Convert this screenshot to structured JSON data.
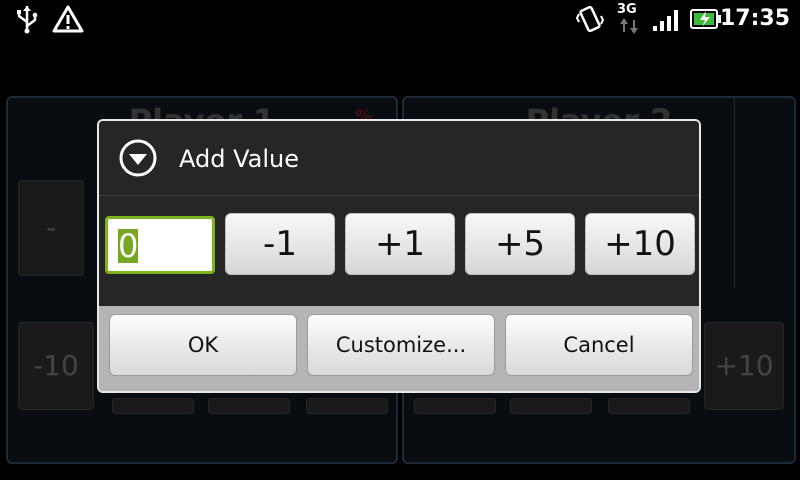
{
  "status_bar": {
    "time": "17:35",
    "network": "3G",
    "icons": [
      "usb-icon",
      "warning-icon",
      "vibrate-icon",
      "network-3g-icon",
      "signal-icon",
      "battery-charging-icon"
    ]
  },
  "background": {
    "panels": [
      {
        "title": "Player 1",
        "minus_label": "-",
        "minus10_label": "-10"
      },
      {
        "title": "Player 2",
        "plus10_label": "+10"
      }
    ]
  },
  "dialog": {
    "title": "Add Value",
    "input_value": "0",
    "value_buttons": [
      "-1",
      "+1",
      "+5",
      "+10"
    ],
    "footer_buttons": [
      "OK",
      "Customize...",
      "Cancel"
    ]
  }
}
